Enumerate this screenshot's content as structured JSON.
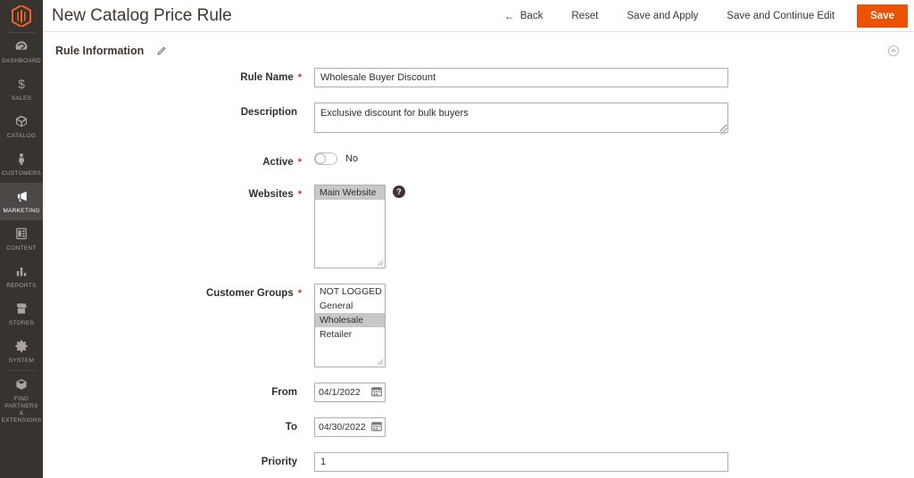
{
  "sidebar": {
    "logo": "magento-logo",
    "items": [
      {
        "label": "DASHBOARD",
        "icon": "dashboard-icon",
        "active": false
      },
      {
        "label": "SALES",
        "icon": "sales-dollar-icon",
        "active": false
      },
      {
        "label": "CATALOG",
        "icon": "catalog-box-icon",
        "active": false
      },
      {
        "label": "CUSTOMERS",
        "icon": "customers-person-icon",
        "active": false
      },
      {
        "label": "MARKETING",
        "icon": "marketing-megaphone-icon",
        "active": true
      },
      {
        "label": "CONTENT",
        "icon": "content-page-icon",
        "active": false
      },
      {
        "label": "REPORTS",
        "icon": "reports-bar-icon",
        "active": false
      },
      {
        "label": "STORES",
        "icon": "stores-building-icon",
        "active": false
      },
      {
        "label": "SYSTEM",
        "icon": "system-gear-icon",
        "active": false
      },
      {
        "label": "FIND PARTNERS\n& EXTENSIONS",
        "icon": "partners-box-icon",
        "active": false
      }
    ],
    "partners_line1": "FIND PARTNERS",
    "partners_line2": "& EXTENSIONS"
  },
  "header": {
    "title": "New Catalog Price Rule",
    "back_label": "Back",
    "back_arrow": "←",
    "reset_label": "Reset",
    "save_and_apply_label": "Save and Apply",
    "save_and_continue_label": "Save and Continue Edit",
    "save_label": "Save",
    "primary_color": "#eb5202"
  },
  "section": {
    "title": "Rule Information",
    "edit_icon": "pencil-icon",
    "collapse_icon": "chevron-up-circle-icon"
  },
  "form": {
    "rule_name": {
      "label": "Rule Name",
      "required": "*",
      "value": "Wholesale Buyer Discount",
      "placeholder": ""
    },
    "description": {
      "label": "Description",
      "required": "",
      "value": "Exclusive discount for bulk buyers",
      "placeholder": ""
    },
    "active": {
      "label": "Active",
      "required": "*",
      "state_label": "No",
      "checked": false
    },
    "websites": {
      "label": "Websites",
      "required": "*",
      "help_icon": "question-mark-icon",
      "help_glyph": "?",
      "options": [
        {
          "label": "Main Website",
          "selected": true
        }
      ]
    },
    "customer_groups": {
      "label": "Customer Groups",
      "required": "*",
      "options": [
        {
          "label": "NOT LOGGED IN",
          "selected": false
        },
        {
          "label": "General",
          "selected": false
        },
        {
          "label": "Wholesale",
          "selected": true
        },
        {
          "label": "Retailer",
          "selected": false
        }
      ]
    },
    "from": {
      "label": "From",
      "required": "",
      "value": "04/1/2022",
      "calendar_icon": "calendar-icon"
    },
    "to": {
      "label": "To",
      "required": "",
      "value": "04/30/2022",
      "calendar_icon": "calendar-icon"
    },
    "priority": {
      "label": "Priority",
      "required": "",
      "value": "1",
      "placeholder": ""
    }
  }
}
